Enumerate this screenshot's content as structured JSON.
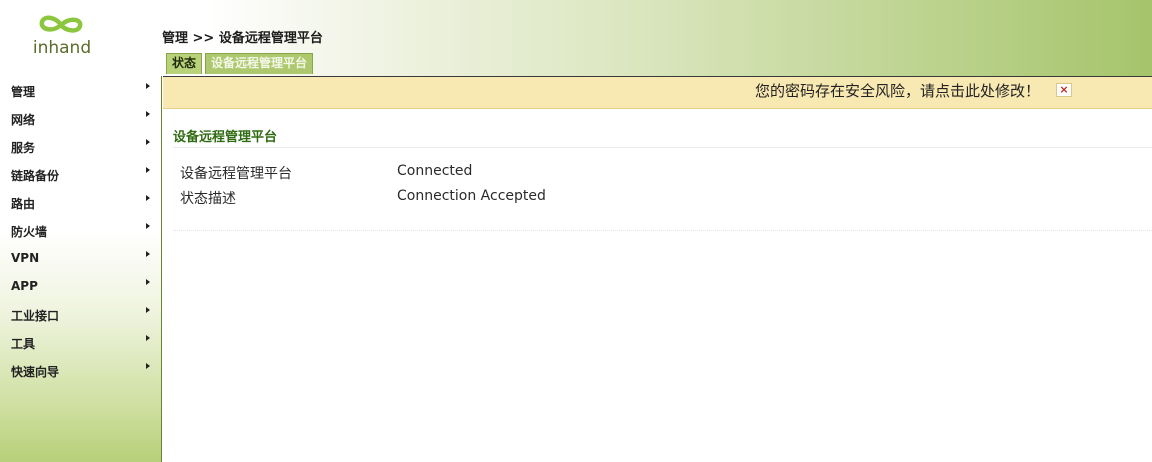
{
  "logo": {
    "text": "inhand",
    "icon": "infinity-logo-icon"
  },
  "breadcrumb": "管理 >> 设备远程管理平台",
  "tabs": [
    {
      "label": "状态",
      "active": true
    },
    {
      "label": "设备远程管理平台",
      "active": false
    }
  ],
  "sidebar": {
    "items": [
      {
        "label": "管理"
      },
      {
        "label": "网络"
      },
      {
        "label": "服务"
      },
      {
        "label": "链路备份"
      },
      {
        "label": "路由"
      },
      {
        "label": "防火墙"
      },
      {
        "label": "VPN"
      },
      {
        "label": "APP"
      },
      {
        "label": "工业接口"
      },
      {
        "label": "工具"
      },
      {
        "label": "快速向导"
      }
    ]
  },
  "warning": {
    "text": "您的密码存在安全风险，请点击此处修改！",
    "close_icon": "×"
  },
  "section": {
    "title": "设备远程管理平台",
    "rows": [
      {
        "label": "设备远程管理平台",
        "value": "Connected"
      },
      {
        "label": "状态描述",
        "value": "Connection Accepted"
      }
    ]
  },
  "colors": {
    "accent_green": "#2f6b12",
    "header_gradient_end": "#a6c46b",
    "warning_bg": "#f8e8b2"
  }
}
